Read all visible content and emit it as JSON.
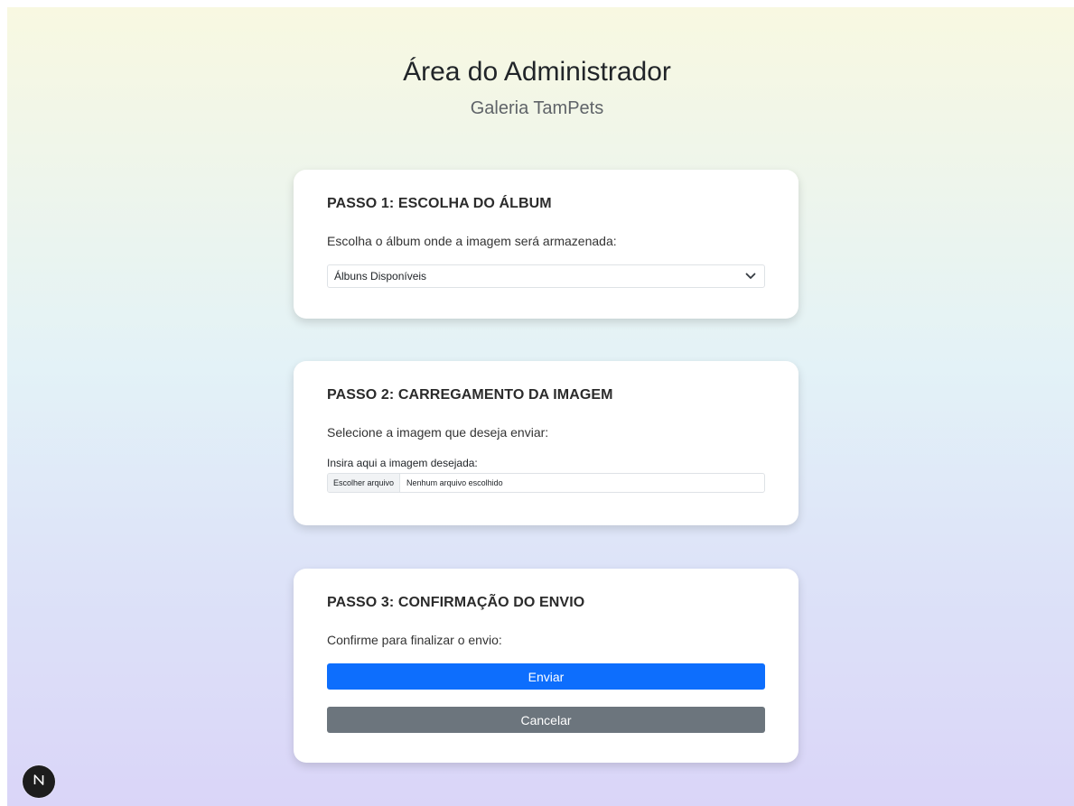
{
  "header": {
    "title": "Área do Administrador",
    "subtitle": "Galeria TamPets"
  },
  "step1": {
    "title": "PASSO 1: ESCOLHA DO ÁLBUM",
    "description": "Escolha o álbum onde a imagem será armazenada:",
    "select_value": "Álbuns Disponíveis"
  },
  "step2": {
    "title": "PASSO 2: CARREGAMENTO DA IMAGEM",
    "description": "Selecione a imagem que deseja enviar:",
    "file_label": "Insira aqui a imagem desejada:",
    "file_button": "Escolher arquivo",
    "file_status": "Nenhum arquivo escolhido"
  },
  "step3": {
    "title": "PASSO 3: CONFIRMAÇÃO DO ENVIO",
    "description": "Confirme para finalizar o envio:",
    "submit_label": "Enviar",
    "cancel_label": "Cancelar"
  },
  "badge": {
    "letter": "N"
  },
  "colors": {
    "primary": "#0d6efd",
    "secondary": "#6c757d",
    "gradient_top": "#f8f8e1",
    "gradient_bottom": "#dad5f8"
  },
  "icons": {
    "select_chevron": "chevron-down-icon",
    "badge": "nextjs-logo-icon"
  }
}
